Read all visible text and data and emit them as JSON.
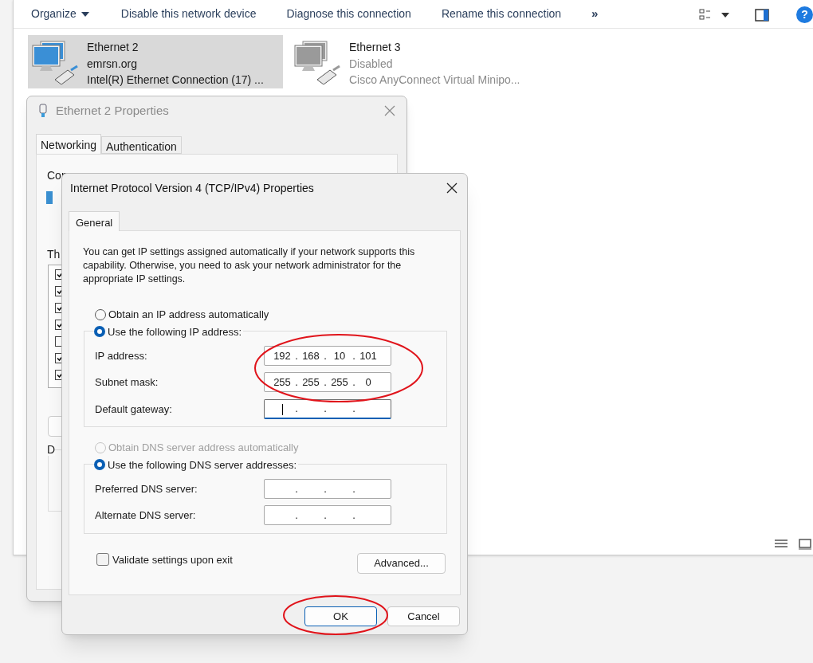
{
  "explorer": {
    "toolbar": [
      {
        "kind": "menu",
        "label": "Organize"
      },
      {
        "kind": "text",
        "label": "Disable this network device"
      },
      {
        "kind": "text",
        "label": "Diagnose this connection"
      },
      {
        "kind": "text",
        "label": "Rename this connection"
      },
      {
        "kind": "more",
        "label": "»"
      }
    ],
    "help_label": "?",
    "connections": [
      {
        "name": "Ethernet 2",
        "status": "emrsn.org",
        "device": "Intel(R) Ethernet Connection (17) ...",
        "selected": true,
        "disabled": false
      },
      {
        "name": "Ethernet 3",
        "status": "Disabled",
        "device": "Cisco AnyConnect Virtual Minipo...",
        "selected": false,
        "disabled": true
      }
    ]
  },
  "properties_dialog": {
    "title": "Ethernet 2 Properties",
    "tabs": [
      {
        "label": "Networking",
        "selected": true
      },
      {
        "label": "Authentication",
        "selected": false
      }
    ],
    "connect_label": "Con",
    "items_label": "Th",
    "description_label": "D",
    "items": [
      {
        "checked": true
      },
      {
        "checked": true
      },
      {
        "checked": true
      },
      {
        "checked": true
      },
      {
        "checked": false
      },
      {
        "checked": true
      },
      {
        "checked": true
      }
    ]
  },
  "ipv4_dialog": {
    "title": "Internet Protocol Version 4 (TCP/IPv4) Properties",
    "tabs": [
      {
        "label": "General",
        "selected": true
      }
    ],
    "description": "You can get IP settings assigned automatically if your network supports this capability. Otherwise, you need to ask your network administrator for the appropriate IP settings.",
    "ip_options": [
      {
        "label": "Obtain an IP address automatically",
        "selected": false,
        "disabled": false
      },
      {
        "label": "Use the following IP address:",
        "selected": true,
        "disabled": false
      }
    ],
    "ip_fields": [
      {
        "label": "IP address:",
        "separators": [
          ".",
          ".",
          "."
        ],
        "octets": [
          "192",
          "168",
          "10",
          "101"
        ],
        "focused": false
      },
      {
        "label": "Subnet mask:",
        "separators": [
          ".",
          ".",
          "."
        ],
        "octets": [
          "255",
          "255",
          "255",
          "0"
        ],
        "focused": false
      },
      {
        "label": "Default gateway:",
        "separators": [
          ".",
          ".",
          "."
        ],
        "focused": true
      }
    ],
    "dns_options": [
      {
        "label": "Obtain DNS server address automatically",
        "selected": false,
        "disabled": true
      },
      {
        "label": "Use the following DNS server addresses:",
        "selected": true,
        "disabled": false
      }
    ],
    "dns_fields": [
      {
        "label": "Preferred DNS server:",
        "separators": [
          ".",
          ".",
          "."
        ],
        "focused": false
      },
      {
        "label": "Alternate DNS server:",
        "separators": [
          ".",
          ".",
          "."
        ],
        "focused": false
      }
    ],
    "validate": {
      "label": "Validate settings upon exit",
      "checked": false
    },
    "advanced_button": "Advanced...",
    "buttons": [
      {
        "label": "OK",
        "default": true
      },
      {
        "label": "Cancel",
        "default": false
      }
    ]
  }
}
